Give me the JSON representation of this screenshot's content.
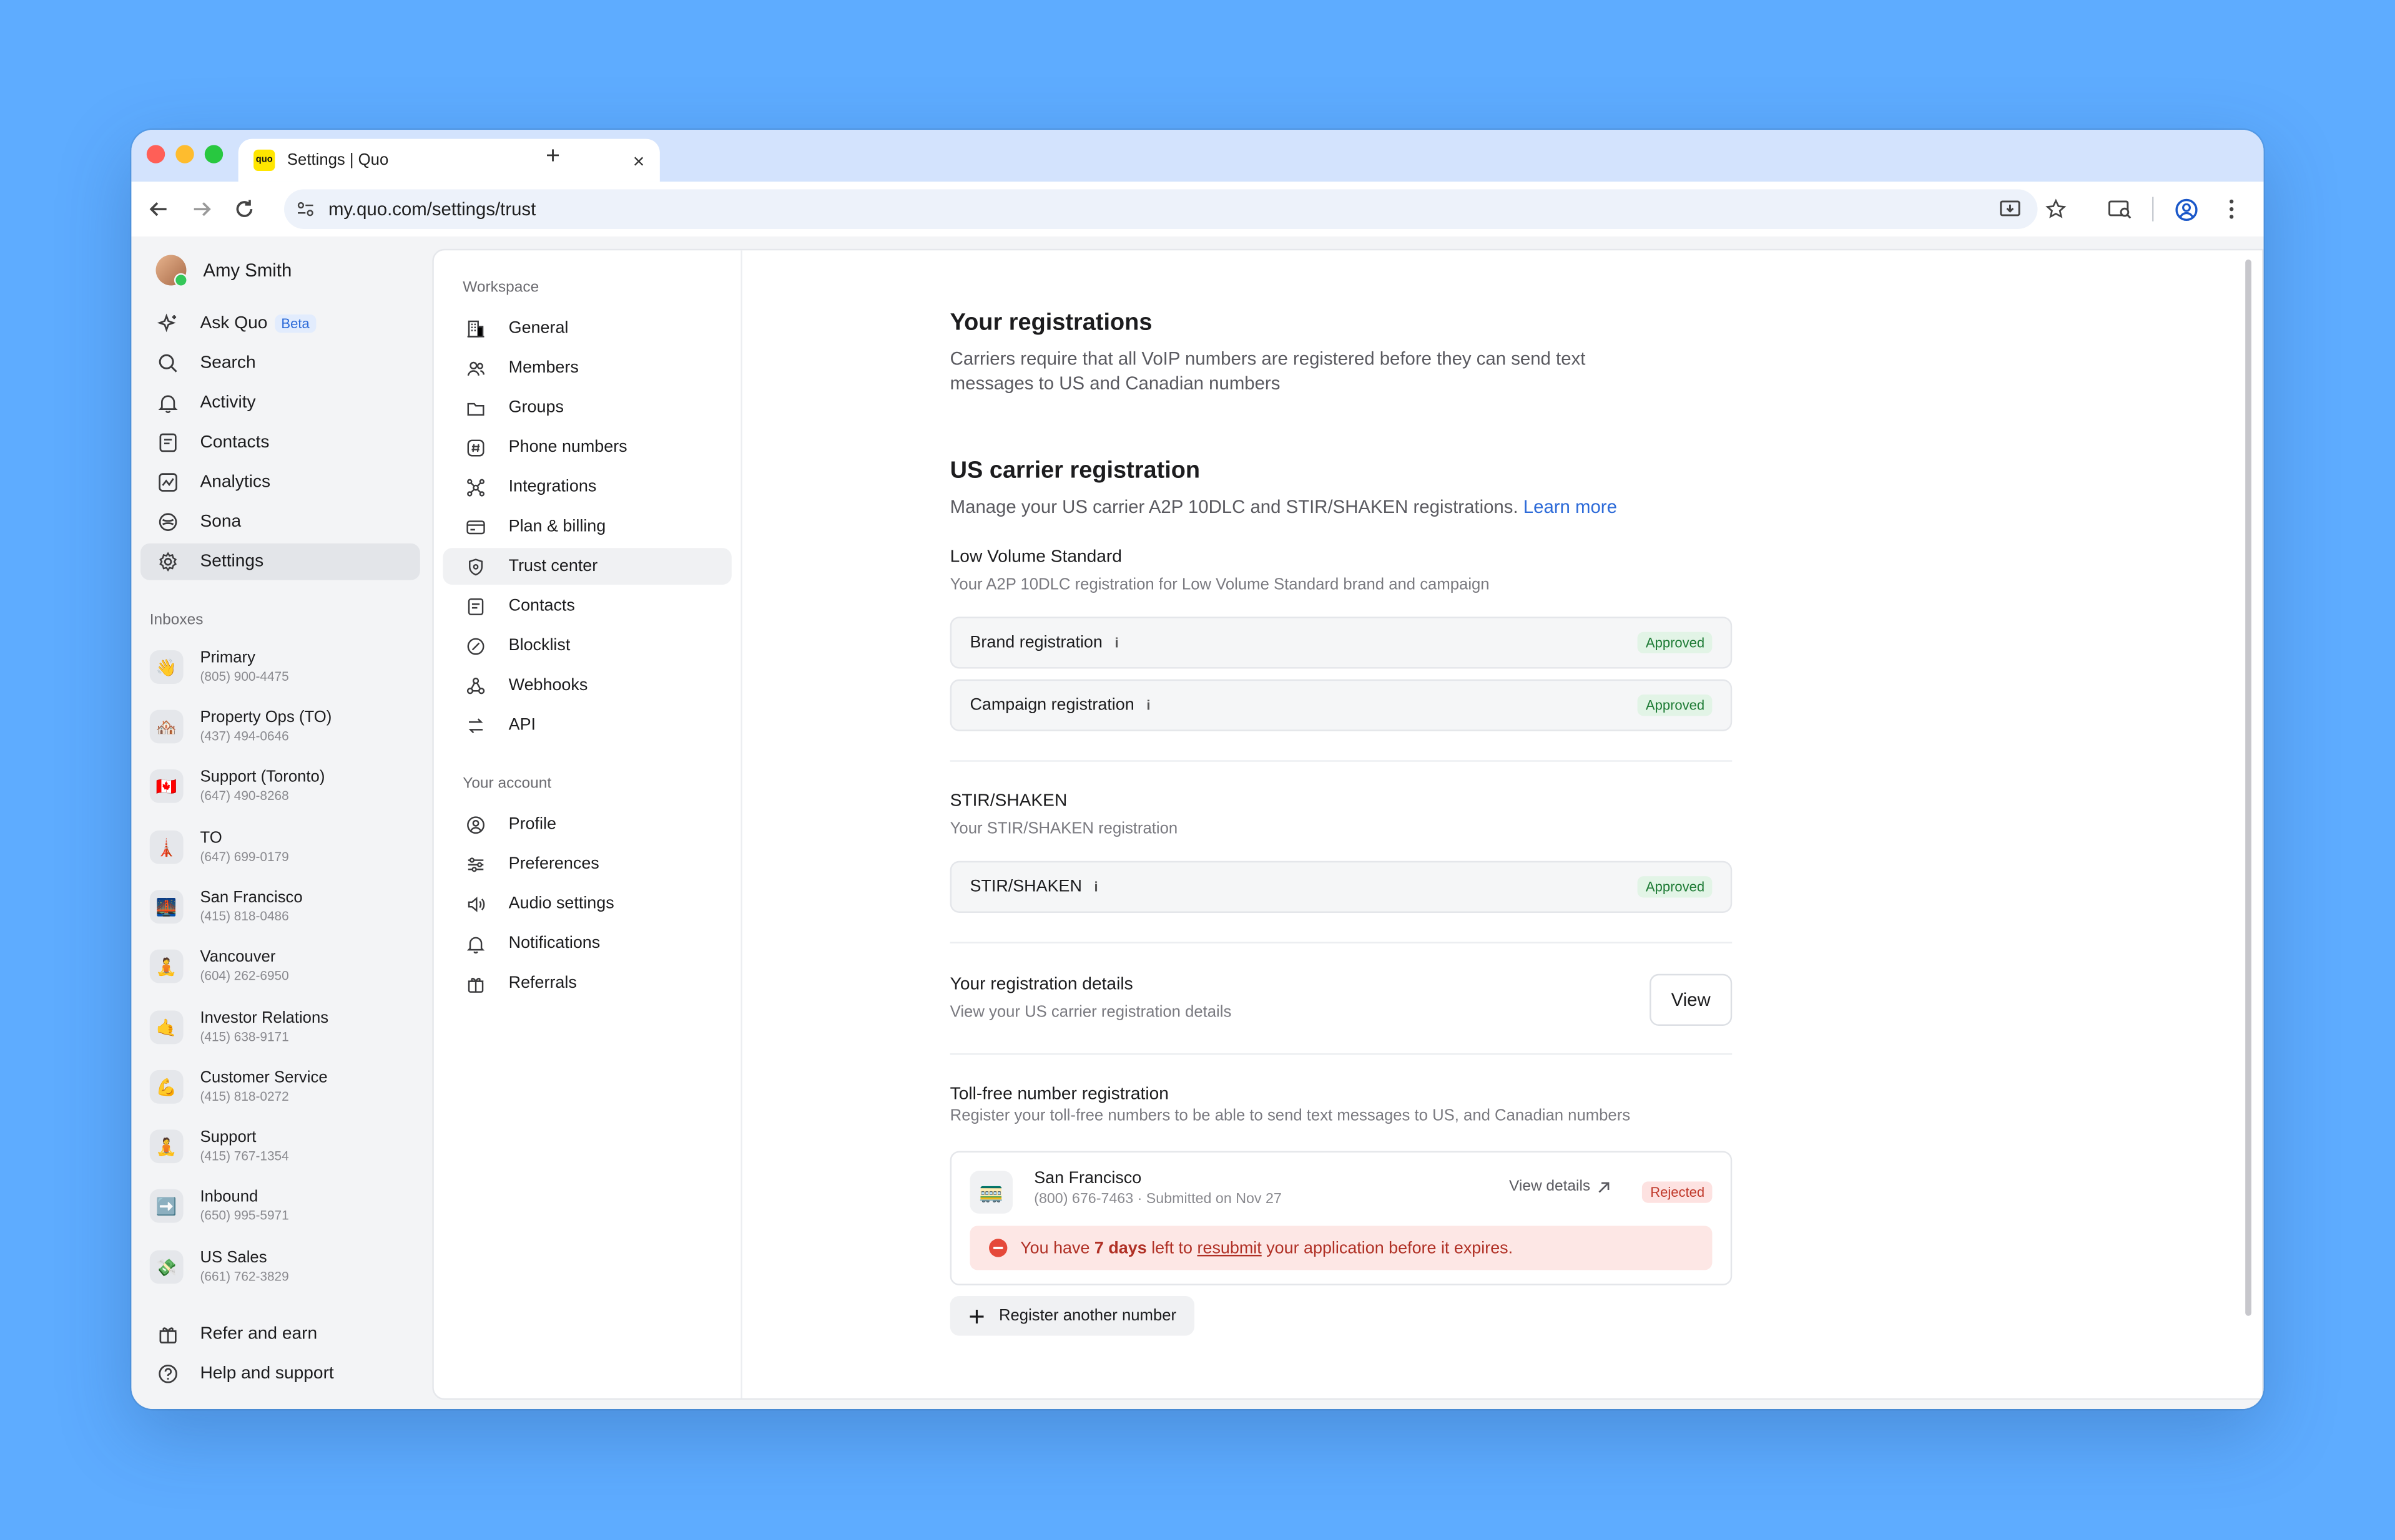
{
  "browser": {
    "tab_title": "Settings | Quo",
    "favicon_text": "quo",
    "url": "my.quo.com/settings/trust"
  },
  "sidebar": {
    "user_name": "Amy Smith",
    "items": [
      {
        "label": "Ask Quo",
        "icon": "sparkles-icon"
      },
      {
        "label": "Search",
        "icon": "search-icon"
      },
      {
        "label": "Activity",
        "icon": "bell-icon"
      },
      {
        "label": "Contacts",
        "icon": "contacts-icon"
      },
      {
        "label": "Analytics",
        "icon": "analytics-icon"
      },
      {
        "label": "Sona",
        "icon": "sona-icon"
      },
      {
        "label": "Settings",
        "icon": "gear-icon"
      }
    ],
    "beta_label": "Beta",
    "inboxes_title": "Inboxes",
    "inboxes": [
      {
        "name": "Primary",
        "phone": "(805) 900-4475",
        "emoji": "👋"
      },
      {
        "name": "Property Ops (TO)",
        "phone": "(437) 494-0646",
        "emoji": "🏘️"
      },
      {
        "name": "Support (Toronto)",
        "phone": "(647) 490-8268",
        "emoji": "🇨🇦"
      },
      {
        "name": "TO",
        "phone": "(647) 699-0179",
        "emoji": "🗼"
      },
      {
        "name": "San Francisco",
        "phone": "(415) 818-0486",
        "emoji": "🌉"
      },
      {
        "name": "Vancouver",
        "phone": "(604) 262-6950",
        "emoji": "🧘"
      },
      {
        "name": "Investor Relations",
        "phone": "(415) 638-9171",
        "emoji": "🤙"
      },
      {
        "name": "Customer Service",
        "phone": "(415) 818-0272",
        "emoji": "💪"
      },
      {
        "name": "Support",
        "phone": "(415) 767-1354",
        "emoji": "🧘"
      },
      {
        "name": "Inbound",
        "phone": "(650) 995-5971",
        "emoji": "➡️"
      },
      {
        "name": "US Sales",
        "phone": "(661) 762-3829",
        "emoji": "💸"
      }
    ],
    "footer": [
      {
        "label": "Refer and earn",
        "icon": "gift-icon"
      },
      {
        "label": "Help and support",
        "icon": "help-icon"
      }
    ]
  },
  "settings_nav": {
    "workspace_title": "Workspace",
    "workspace": [
      {
        "label": "General",
        "icon": "building-icon"
      },
      {
        "label": "Members",
        "icon": "users-icon"
      },
      {
        "label": "Groups",
        "icon": "folder-icon"
      },
      {
        "label": "Phone numbers",
        "icon": "hash-icon"
      },
      {
        "label": "Integrations",
        "icon": "integrations-icon"
      },
      {
        "label": "Plan & billing",
        "icon": "card-icon"
      },
      {
        "label": "Trust center",
        "icon": "shield-icon"
      },
      {
        "label": "Contacts",
        "icon": "contacts-icon"
      },
      {
        "label": "Blocklist",
        "icon": "block-icon"
      },
      {
        "label": "Webhooks",
        "icon": "webhook-icon"
      },
      {
        "label": "API",
        "icon": "api-icon"
      }
    ],
    "account_title": "Your account",
    "account": [
      {
        "label": "Profile",
        "icon": "profile-icon"
      },
      {
        "label": "Preferences",
        "icon": "sliders-icon"
      },
      {
        "label": "Audio settings",
        "icon": "speaker-icon"
      },
      {
        "label": "Notifications",
        "icon": "bell-icon"
      },
      {
        "label": "Referrals",
        "icon": "gift-icon"
      }
    ]
  },
  "main": {
    "title": "Your registrations",
    "subtitle": "Carriers require that all VoIP numbers are registered before they can send text messages to US and Canadian numbers",
    "us_title": "US carrier registration",
    "us_subtitle": "Manage your US carrier A2P 10DLC and STIR/SHAKEN registrations.",
    "learn_more": "Learn more",
    "lvs_title": "Low Volume Standard",
    "lvs_subtitle": "Your A2P 10DLC registration for Low Volume Standard brand and campaign",
    "brand_label": "Brand registration",
    "brand_status": "Approved",
    "campaign_label": "Campaign registration",
    "campaign_status": "Approved",
    "stir_title": "STIR/SHAKEN",
    "stir_subtitle": "Your STIR/SHAKEN registration",
    "stir_label": "STIR/SHAKEN",
    "stir_status": "Approved",
    "details_title": "Your registration details",
    "details_subtitle": "View your US carrier registration details",
    "view_button": "View",
    "tollfree_title": "Toll-free number registration",
    "tollfree_subtitle": "Register your toll-free numbers to be able to send text messages to US, and Canadian numbers",
    "tollfree_name": "San Francisco",
    "tollfree_meta": "(800) 676-7463 · Submitted on Nov 27",
    "tollfree_emoji": "🚃",
    "view_details": "View details",
    "tollfree_status": "Rejected",
    "alert_pre": "You have ",
    "alert_days": "7 days",
    "alert_mid": " left to ",
    "alert_link": "resubmit",
    "alert_post": " your application before it expires.",
    "register_another": "Register another number"
  },
  "colors": {
    "background": "#5eacff",
    "accent": "#2c6ad8",
    "approved": "#1e7b35",
    "rejected": "#c0392b"
  }
}
